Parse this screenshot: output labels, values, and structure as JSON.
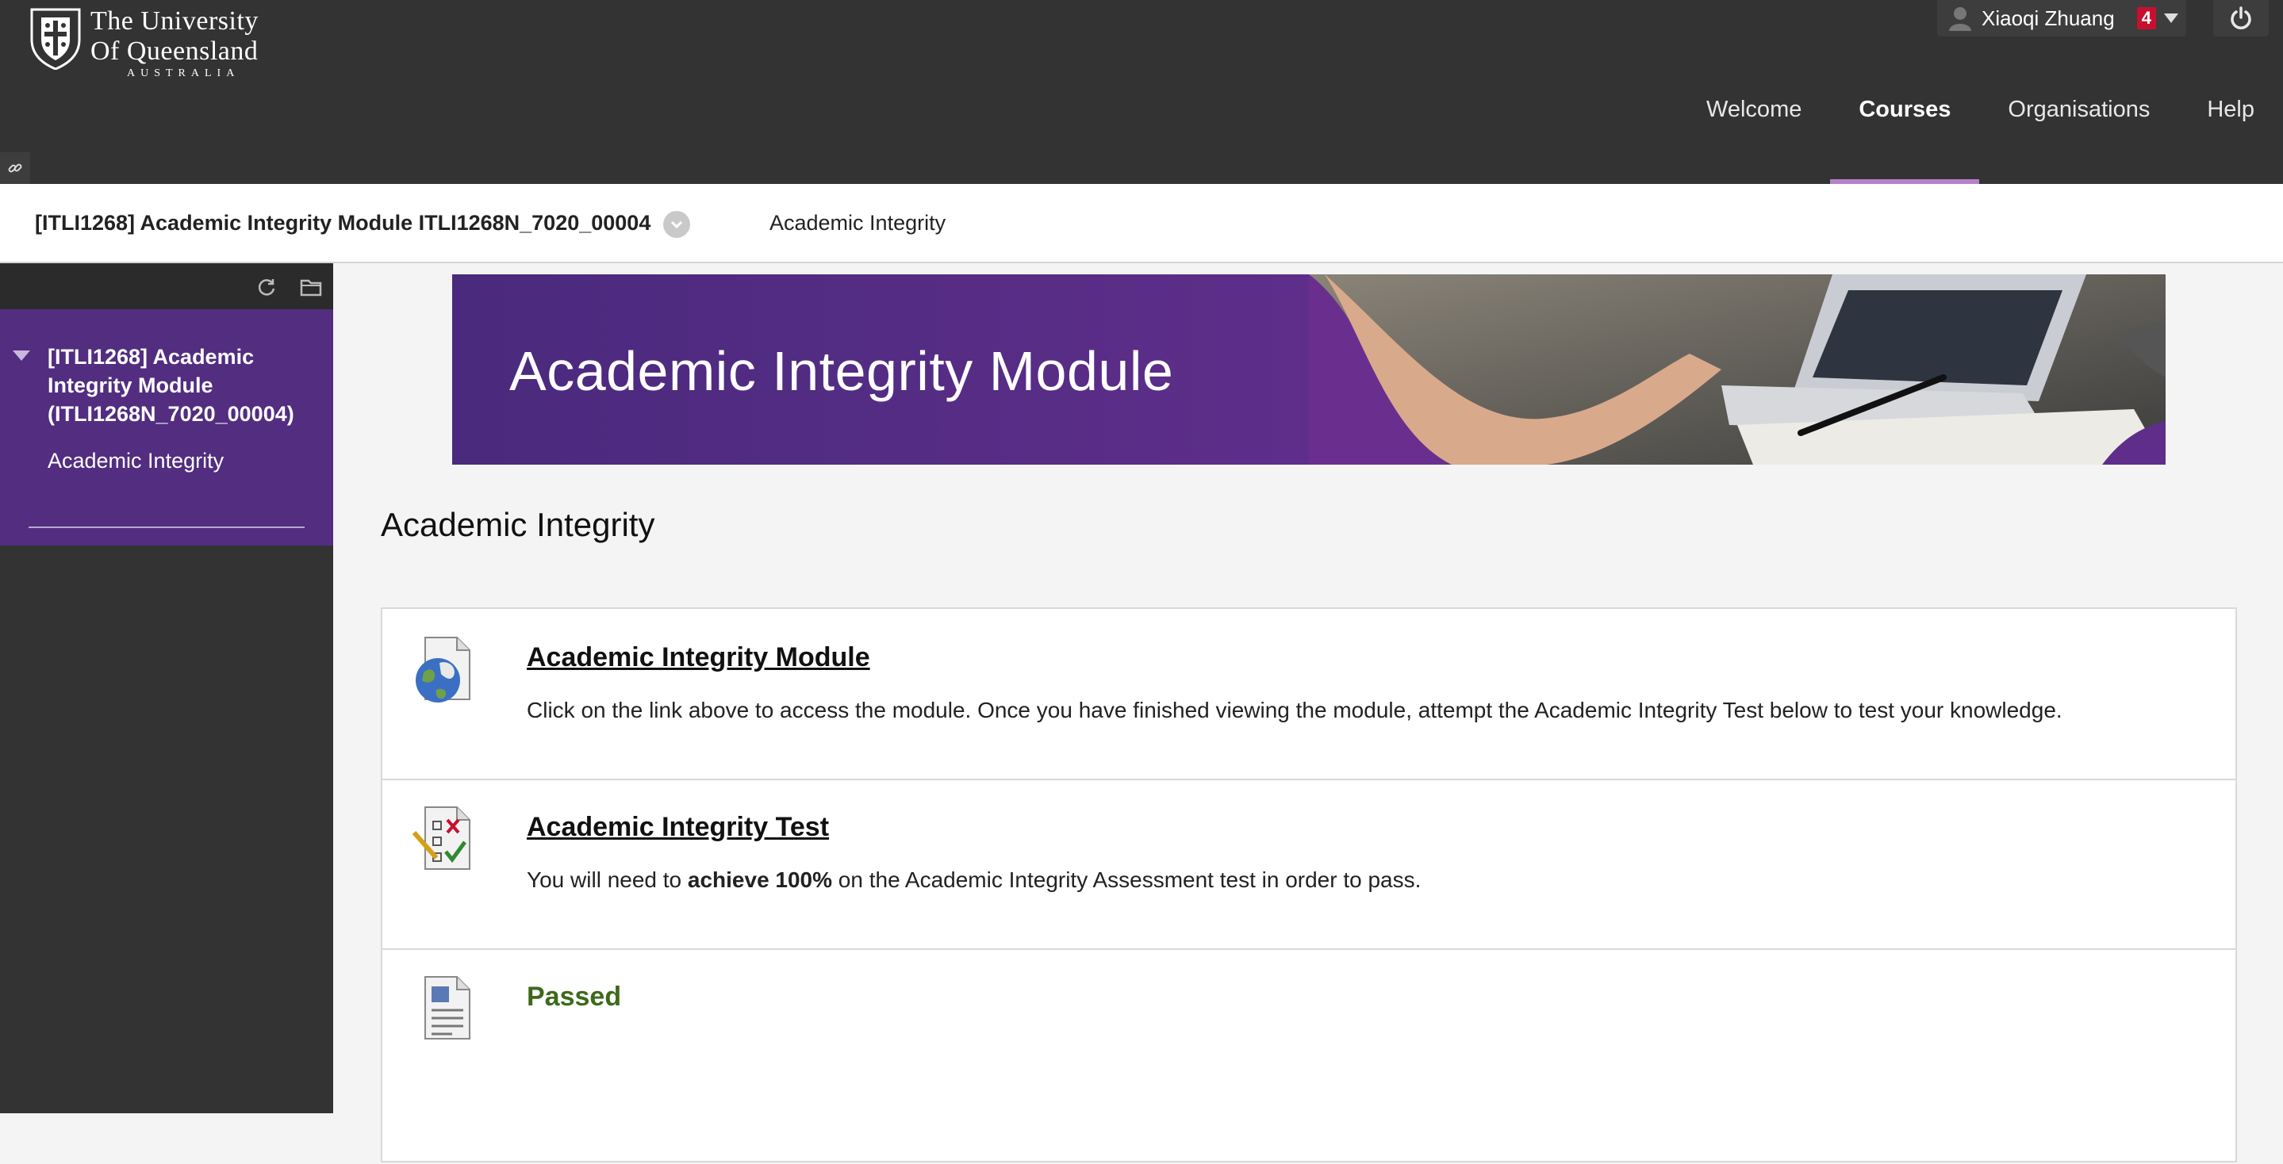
{
  "header": {
    "logo": {
      "line1": "The University",
      "line2": "Of Queensland",
      "line3": "AUSTRALIA"
    },
    "user": {
      "name": "Xiaoqi Zhuang",
      "notification_count": "4"
    },
    "nav": [
      {
        "label": "Welcome",
        "active": false
      },
      {
        "label": "Courses",
        "active": true
      },
      {
        "label": "Organisations",
        "active": false
      },
      {
        "label": "Help",
        "active": false
      }
    ]
  },
  "breadcrumb": {
    "course": "[ITLI1268] Academic Integrity Module ITLI1268N_7020_00004",
    "current": "Academic Integrity"
  },
  "sidebar": {
    "course_title": "[ITLI1268] Academic Integrity Module (ITLI1268N_7020_00004)",
    "items": [
      {
        "label": "Academic Integrity"
      }
    ]
  },
  "banner": {
    "title": "Academic Integrity Module"
  },
  "page_title": "Academic Integrity",
  "content_items": [
    {
      "title": "Academic Integrity Module",
      "description": "Click on the link above to access the module. Once you have finished viewing the module, attempt the Academic Integrity Test below to test your knowledge."
    },
    {
      "title": "Academic Integrity Test",
      "description_pre": "You will need to ",
      "description_bold": "achieve 100%",
      "description_post": " on the Academic Integrity Assessment test in order to pass."
    },
    {
      "title": "Passed"
    }
  ],
  "colors": {
    "header_bg": "#333333",
    "accent_purple": "#522d80",
    "active_tab_underline": "#b681c8",
    "passed_green": "#3c6a1a"
  }
}
